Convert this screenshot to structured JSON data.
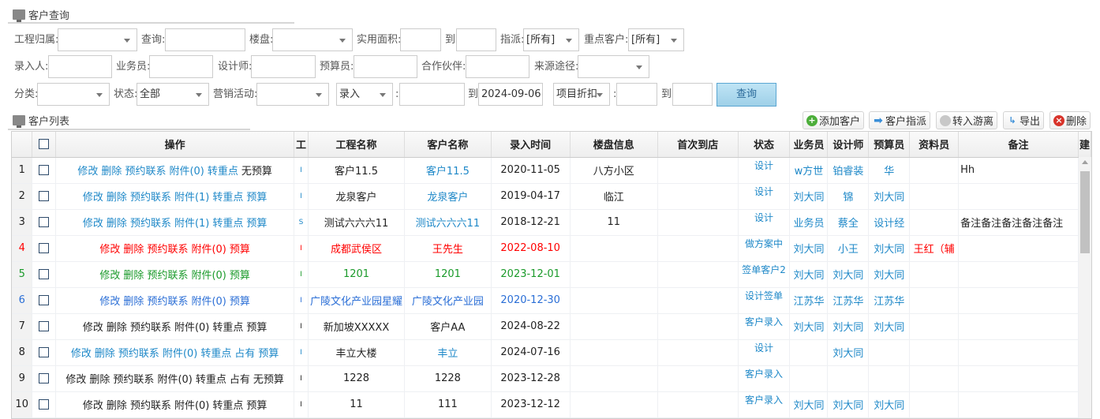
{
  "query_section": {
    "title": "客户查询"
  },
  "form": {
    "project_owner": {
      "label": "工程归属:",
      "value": ""
    },
    "search": {
      "label": "查询:",
      "value": ""
    },
    "building": {
      "label": "楼盘:",
      "value": ""
    },
    "area": {
      "label": "实用面积:",
      "from": "",
      "to_label": "到",
      "to": ""
    },
    "assign": {
      "label": "指派:",
      "value": "[所有]"
    },
    "key_customer": {
      "label": "重点客户:",
      "value": "[所有]"
    },
    "entered_by": {
      "label": "录入人:",
      "value": ""
    },
    "salesman": {
      "label": "业务员:",
      "value": ""
    },
    "designer": {
      "label": "设计师:",
      "value": ""
    },
    "budgeter": {
      "label": "预算员:",
      "value": ""
    },
    "partner": {
      "label": "合作伙伴:",
      "value": ""
    },
    "source": {
      "label": "来源途径:",
      "value": ""
    },
    "category": {
      "label": "分类:",
      "value": ""
    },
    "status": {
      "label": "状态:",
      "value": "全部"
    },
    "campaign": {
      "label": "营销活动:",
      "value": ""
    },
    "date_type": {
      "value": "录入",
      "colon": ":",
      "from": "",
      "to_label": "到",
      "to": "2024-09-06"
    },
    "discount": {
      "value": "项目折扣",
      "colon": ":",
      "from": "",
      "to_label": "到",
      "to": ""
    },
    "query_button": "查询"
  },
  "list_section": {
    "title": "客户列表"
  },
  "toolbar": {
    "add": "添加客户",
    "assign": "客户指派",
    "transfer": "转入游离",
    "export": "导出",
    "delete": "删除"
  },
  "colors": {
    "link": "#1e88c8",
    "red": "#ff0000",
    "green": "#1a9a2a",
    "blue": "#2a6ed6",
    "black": "#222222"
  },
  "columns": [
    "操作",
    "工",
    "工程名称",
    "客户名称",
    "录入时间",
    "楼盘信息",
    "首次到店",
    "状态",
    "业务员",
    "设计师",
    "预算员",
    "资料员",
    "备注",
    "建"
  ],
  "rows": [
    {
      "n": "1",
      "color": "#1e88c8",
      "ops": [
        "修改",
        "删除",
        "预约联系",
        "附件(0)",
        "转重点"
      ],
      "tail": "无预算",
      "tail_color": "#222222",
      "g": "I",
      "proj": "客户11.5",
      "proj_color": "#222222",
      "cust": "客户11.5",
      "cust_color": "#1e88c8",
      "date": "2020-11-05",
      "date_color": "#222222",
      "bld": "八方小区",
      "first": "",
      "status": "设计",
      "sales": "w方世",
      "designer": "铂睿装",
      "budget": "华",
      "data": "",
      "note": "Hh"
    },
    {
      "n": "2",
      "color": "#1e88c8",
      "ops": [
        "修改",
        "删除",
        "预约联系",
        "附件(1)",
        "转重点",
        "预算"
      ],
      "tail": "",
      "tail_color": "",
      "g": "I",
      "proj": "龙泉客户",
      "proj_color": "#222222",
      "cust": "龙泉客户",
      "cust_color": "#1e88c8",
      "date": "2019-04-17",
      "date_color": "#222222",
      "bld": "临江",
      "first": "",
      "status": "设计",
      "sales": "刘大同",
      "designer": "锦",
      "budget": "刘大同",
      "data": "",
      "note": ""
    },
    {
      "n": "3",
      "color": "#1e88c8",
      "ops": [
        "修改",
        "删除",
        "预约联系",
        "附件(1)",
        "转重点",
        "预算"
      ],
      "tail": "",
      "tail_color": "",
      "g": "S",
      "proj": "测试六六六11",
      "proj_color": "#222222",
      "cust": "测试六六六11",
      "cust_color": "#1e88c8",
      "date": "2018-12-21",
      "date_color": "#222222",
      "bld": "11",
      "first": "",
      "status": "设计",
      "sales": "业务员",
      "designer": "蔡全",
      "budget": "设计经",
      "data": "",
      "note": "备注备注备注备注备注"
    },
    {
      "n": "4",
      "color": "#ff0000",
      "ops": [
        "修改",
        "删除",
        "预约联系",
        "附件(0)",
        "预算"
      ],
      "tail": "",
      "tail_color": "",
      "g": "I",
      "proj": "成都武侯区",
      "proj_color": "#ff0000",
      "cust": "王先生",
      "cust_color": "#ff0000",
      "date": "2022-08-10",
      "date_color": "#ff0000",
      "bld": "",
      "first": "",
      "status": "做方案中",
      "sales": "刘大同",
      "designer": "小王",
      "budget": "刘大同",
      "data": "王红（辅",
      "note": ""
    },
    {
      "n": "5",
      "color": "#1a9a2a",
      "ops": [
        "修改",
        "删除",
        "预约联系",
        "附件(0)",
        "预算"
      ],
      "tail": "",
      "tail_color": "",
      "g": "I",
      "proj": "1201",
      "proj_color": "#1a9a2a",
      "cust": "1201",
      "cust_color": "#1a9a2a",
      "date": "2023-12-01",
      "date_color": "#1a9a2a",
      "bld": "",
      "first": "",
      "status": "签单客户2",
      "sales": "刘大同",
      "designer": "刘大同",
      "budget": "刘大同",
      "data": "",
      "note": ""
    },
    {
      "n": "6",
      "color": "#2a6ed6",
      "ops": [
        "修改",
        "删除",
        "预约联系",
        "附件(0)",
        "预算"
      ],
      "tail": "",
      "tail_color": "",
      "g": "I",
      "proj": "广陵文化产业园星耀",
      "proj_color": "#2a6ed6",
      "cust": "广陵文化产业园",
      "cust_color": "#2a6ed6",
      "date": "2020-12-30",
      "date_color": "#2a6ed6",
      "bld": "",
      "first": "",
      "status": "设计签单",
      "sales": "江苏华",
      "designer": "江苏华",
      "budget": "江苏华",
      "data": "",
      "note": ""
    },
    {
      "n": "7",
      "color": "#222222",
      "ops": [
        "修改",
        "删除",
        "预约联系",
        "附件(0)",
        "转重点",
        "预算"
      ],
      "tail": "",
      "tail_color": "",
      "g": "I",
      "proj": "新加坡XXXXX",
      "proj_color": "#222222",
      "cust": "客户AA",
      "cust_color": "#222222",
      "date": "2024-08-22",
      "date_color": "#222222",
      "bld": "",
      "first": "",
      "status": "客户录入",
      "sales": "刘大同",
      "designer": "刘大同",
      "budget": "刘大同",
      "data": "",
      "note": ""
    },
    {
      "n": "8",
      "color": "#1e88c8",
      "ops": [
        "修改",
        "删除",
        "预约联系",
        "附件(0)",
        "转重点",
        "占有",
        "预算"
      ],
      "tail": "",
      "tail_color": "",
      "g": "I",
      "proj": "丰立大楼",
      "proj_color": "#222222",
      "cust": "丰立",
      "cust_color": "#1e88c8",
      "date": "2024-07-16",
      "date_color": "#222222",
      "bld": "",
      "first": "",
      "status": "设计",
      "sales": "",
      "designer": "刘大同",
      "budget": "",
      "data": "",
      "note": ""
    },
    {
      "n": "9",
      "color": "#222222",
      "ops": [
        "修改",
        "删除",
        "预约联系",
        "附件(0)",
        "转重点",
        "占有",
        "无预算"
      ],
      "tail": "",
      "tail_color": "",
      "g": "I",
      "proj": "1228",
      "proj_color": "#222222",
      "cust": "1228",
      "cust_color": "#222222",
      "date": "2023-12-28",
      "date_color": "#222222",
      "bld": "",
      "first": "",
      "status": "客户录入",
      "sales": "",
      "designer": "",
      "budget": "",
      "data": "",
      "note": ""
    },
    {
      "n": "10",
      "color": "#222222",
      "ops": [
        "修改",
        "删除",
        "预约联系",
        "附件(0)",
        "转重点",
        "预算"
      ],
      "tail": "",
      "tail_color": "",
      "g": "I",
      "proj": "11",
      "proj_color": "#222222",
      "cust": "111",
      "cust_color": "#222222",
      "date": "2023-12-12",
      "date_color": "#222222",
      "bld": "",
      "first": "",
      "status": "客户录入",
      "sales": "刘大同",
      "designer": "刘大同",
      "budget": "刘大同",
      "data": "",
      "note": ""
    }
  ]
}
